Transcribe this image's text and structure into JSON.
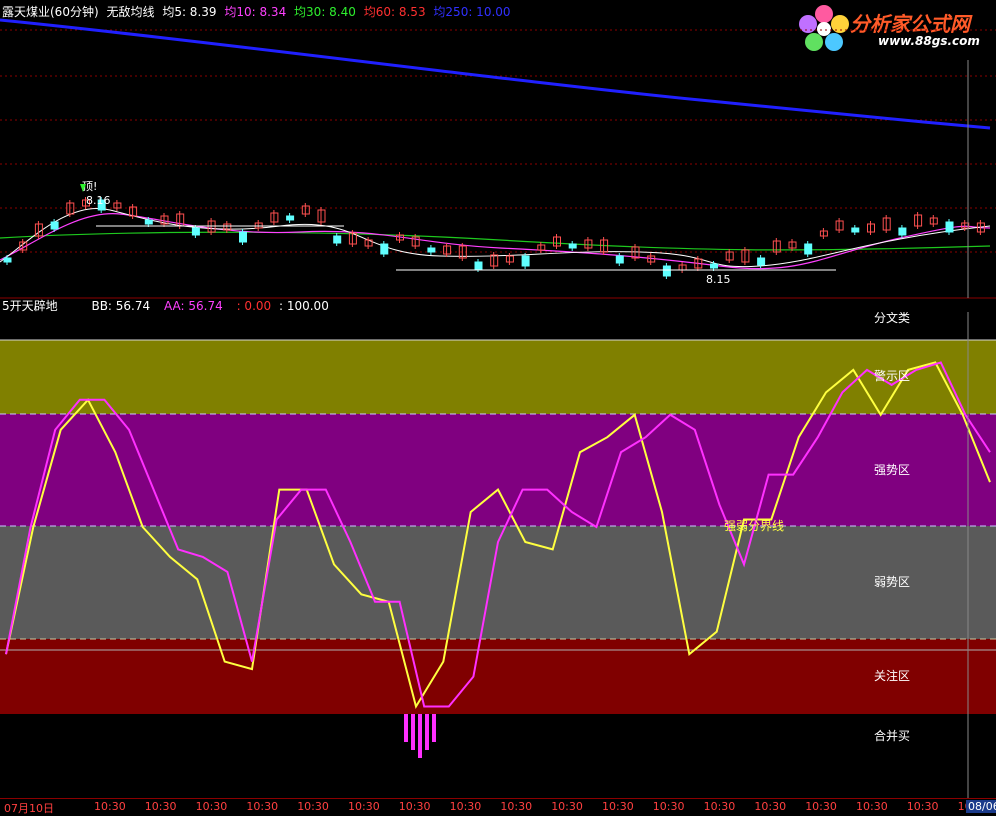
{
  "header": {
    "stock": "露天煤业(60分钟)",
    "indicator": "无敌均线",
    "ma5": "均5: 8.39",
    "ma10": "均10: 8.34",
    "ma30": "均30: 8.40",
    "ma60": "均60: 8.53",
    "ma250": "均250: 10.00"
  },
  "logo": {
    "title": "分析家公式网",
    "url": "www.88gs.com"
  },
  "top_annotations": {
    "peak_label": "顶!",
    "high_price": "8.16",
    "low_price": "8.15"
  },
  "indicator_header": {
    "name": "5开天辟地",
    "bb": "BB: 56.74",
    "aa": "AA: 56.74",
    "v1": ": 0.00",
    "v2": ": 100.00"
  },
  "zones": {
    "top_cut": "分文类",
    "warning": "警示区",
    "strong": "强势区",
    "divider": "强弱分界线",
    "weak": "弱势区",
    "watch": "关注区",
    "buy": "合并买"
  },
  "time_axis": {
    "first": "07月10日",
    "tick": "10:30",
    "last": "08/06"
  },
  "colors": {
    "ma250": "#2020ff",
    "ma60": "#1ec81e",
    "ma30": "#ffffff",
    "ma10": "#ff40ff",
    "ma5": "#ffffff",
    "bb_line": "#ff30ff",
    "aa_line": "#ffff40",
    "zone_warning": "#808000",
    "zone_strong": "#800080",
    "zone_weak": "#5a5a5a",
    "zone_watch": "#800000"
  },
  "chart_data": [
    {
      "type": "line",
      "title": "",
      "series": [
        {
          "name": "均250",
          "y": [
            10.0
          ]
        }
      ]
    },
    {
      "type": "line",
      "title": "",
      "ylim": [
        0,
        100
      ],
      "series": [
        {
          "name": "BB",
          "values": [
            16,
            50,
            76,
            84,
            84,
            76,
            60,
            44,
            42,
            38,
            14,
            52,
            60,
            60,
            46,
            30,
            30,
            2,
            2,
            10,
            46,
            60,
            60,
            54,
            50,
            70,
            74,
            80,
            76,
            56,
            40,
            64,
            64,
            74,
            86,
            92,
            88,
            92,
            94,
            80,
            70
          ]
        },
        {
          "name": "AA",
          "values": [
            16,
            50,
            76,
            84,
            70,
            50,
            42,
            36,
            14,
            12,
            60,
            60,
            40,
            32,
            30,
            2,
            14,
            54,
            60,
            46,
            44,
            70,
            74,
            80,
            54,
            16,
            22,
            52,
            52,
            74,
            86,
            92,
            80,
            92,
            94,
            80,
            62
          ]
        }
      ]
    }
  ]
}
